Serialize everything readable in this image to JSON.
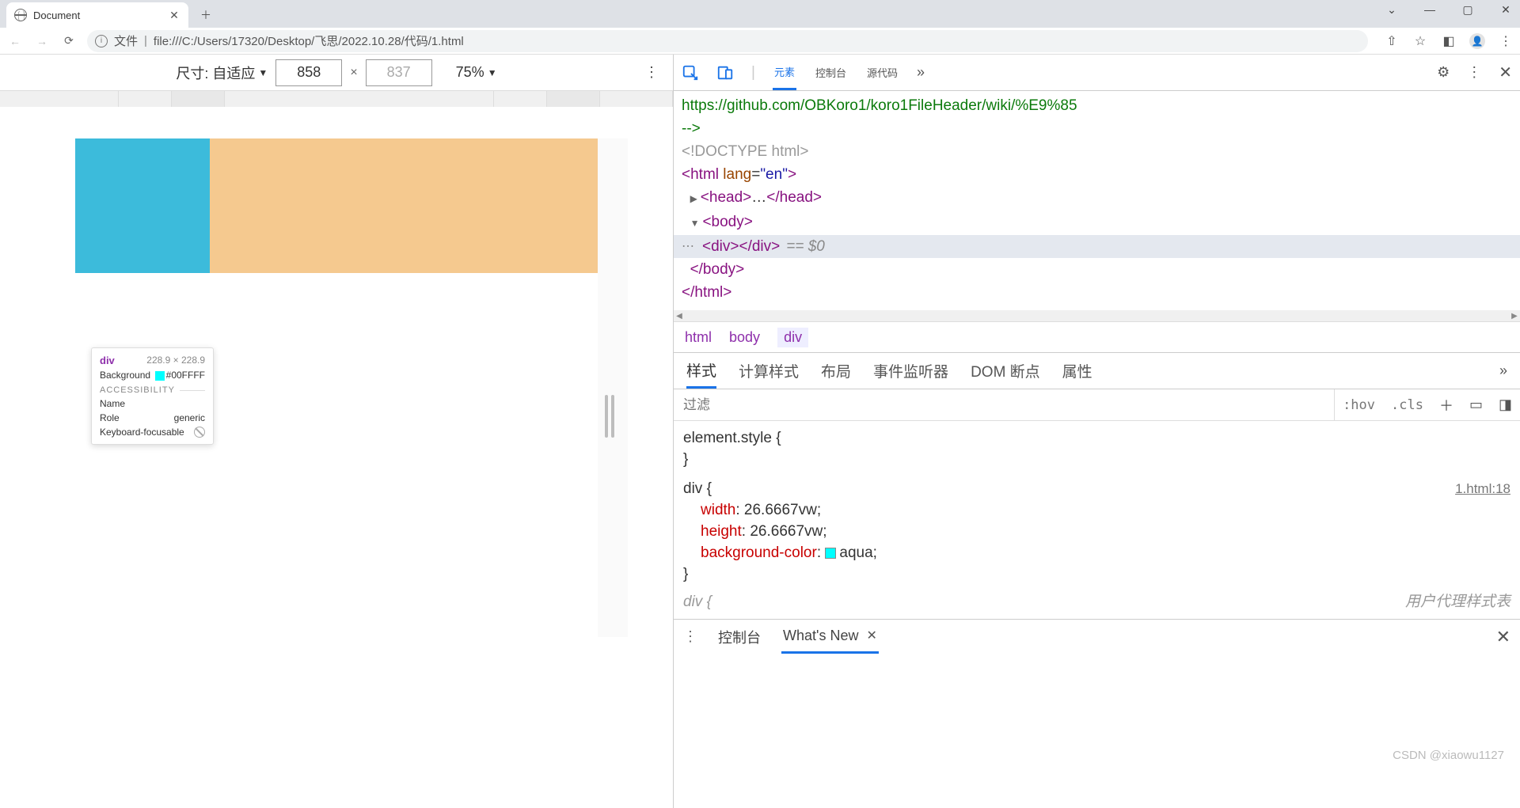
{
  "browser": {
    "tab_title": "Document",
    "url_prefix": "文件",
    "url": "file:///C:/Users/17320/Desktop/飞思/2022.10.28/代码/1.html"
  },
  "device_bar": {
    "size_label": "尺寸: 自适应",
    "width": "858",
    "height": "837",
    "zoom": "75%"
  },
  "tooltip": {
    "element": "div",
    "dims": "228.9 × 228.9",
    "bg_label": "Background",
    "bg_value": "#00FFFF",
    "section": "ACCESSIBILITY",
    "name_label": "Name",
    "role_label": "Role",
    "role_value": "generic",
    "kbd_label": "Keyboard-focusable"
  },
  "devtools": {
    "tabs": {
      "elements": "元素",
      "console": "控制台",
      "sources": "源代码"
    },
    "dom": {
      "url_comment": "https://github.com/OBKoro1/koro1FileHeader/wiki/%E9%85",
      "comment_end": "-->",
      "doctype": "<!DOCTYPE html>",
      "html_open": "<html lang=\"en\">",
      "head": "<head>…</head>",
      "body_open": "<body>",
      "div_line": "<div></div>",
      "eq": "== $0",
      "body_close": "</body>",
      "html_close": "</html>"
    },
    "breadcrumb": {
      "html": "html",
      "body": "body",
      "div": "div"
    },
    "style_tabs": {
      "styles": "样式",
      "computed": "计算样式",
      "layout": "布局",
      "listeners": "事件监听器",
      "dom_bp": "DOM 断点",
      "props": "属性"
    },
    "filter_placeholder": "过滤",
    "hov": ":hov",
    "cls": ".cls",
    "styles": {
      "elstyle": "element.style {",
      "close": "}",
      "rule_sel": "div {",
      "src": "1.html:18",
      "width_p": "width",
      "width_v": "26.6667vw;",
      "height_p": "height",
      "height_v": "26.6667vw;",
      "bg_p": "background-color",
      "bg_v": "aqua;",
      "next_rule": "div {",
      "ua_label": "用户代理样式表"
    },
    "drawer": {
      "console": "控制台",
      "whatsnew": "What's New"
    }
  },
  "watermark": "CSDN @xiaowu1127"
}
